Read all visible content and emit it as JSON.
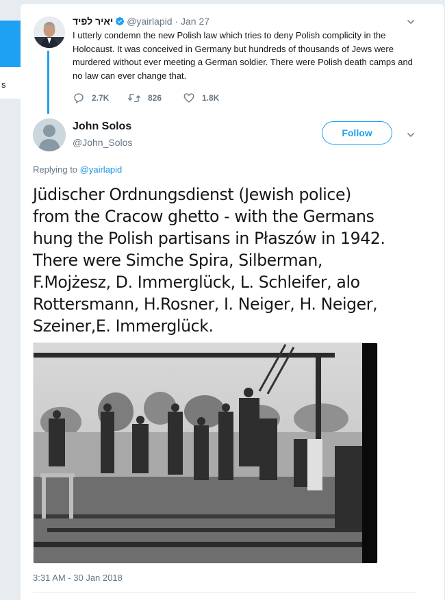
{
  "background": {
    "side_text": "s",
    "brand_color": "#1da1f2"
  },
  "parent_tweet": {
    "name": "יאיר לפיד",
    "handle": "@yairlapid",
    "separator": "·",
    "date": "Jan 27",
    "text": "I utterly condemn the new Polish law  which tries to deny Polish complicity in the Holocaust. It was conceived in Germany but hundreds of thousands of Jews were murdered without ever meeting a German soldier. There were Polish death camps and no law can ever change that.",
    "replies": "2.7K",
    "retweets": "826",
    "likes": "1.8K",
    "icons": [
      "verified-badge-icon",
      "reply-icon",
      "retweet-icon",
      "like-icon",
      "chevron-down-icon"
    ]
  },
  "reply_tweet": {
    "name": "John Solos",
    "handle": "@John_Solos",
    "follow_label": "Follow",
    "replying_prefix": "Replying to ",
    "replying_to": "@yairlapid",
    "text": "Jüdischer  Ordnungsdienst (Jewish police)\nfrom the Cracow ghetto - with the  Germans\nhung the Polish partisans in Płaszów in 1942.\nThere were Simche  Spira, Silberman,\nF.Mojżesz, D. Immerglück, L. Schleifer, alo\nRottersmann, H.Rosner, I. Neiger, H. Neiger,\nSzeiner,E. Immerglück.",
    "timestamp": "3:31 AM - 30 Jan 2018",
    "icons": [
      "default-avatar-icon",
      "chevron-down-icon"
    ]
  }
}
